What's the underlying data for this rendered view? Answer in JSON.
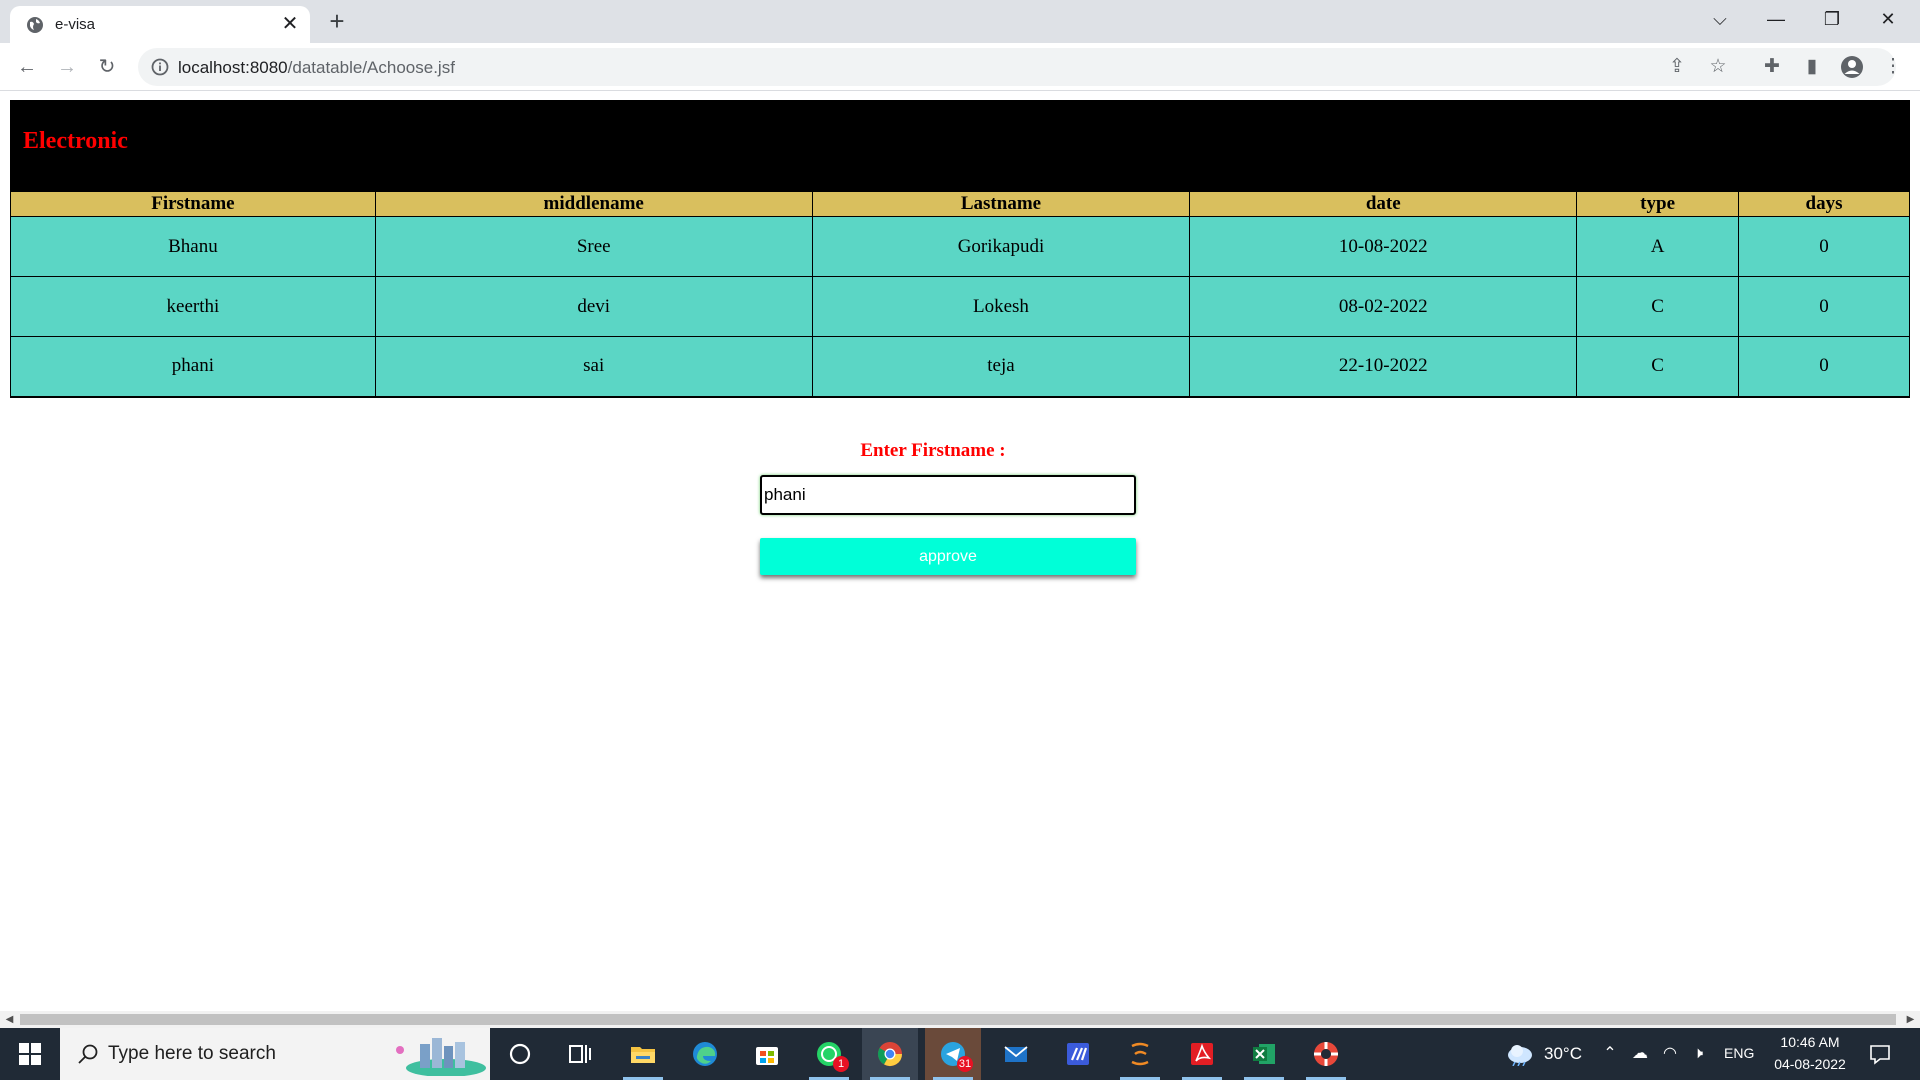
{
  "browser": {
    "tab_title": "e-visa",
    "url_host": "localhost:8080",
    "url_path": "/datatable/Achoose.jsf"
  },
  "page": {
    "banner_title": "Electronic",
    "table": {
      "headers": [
        "Firstname",
        "middlename",
        "Lastname",
        "date",
        "type",
        "days"
      ],
      "rows": [
        [
          "Bhanu",
          "Sree",
          "Gorikapudi",
          "10-08-2022",
          "A",
          "0"
        ],
        [
          "keerthi",
          "devi",
          "Lokesh",
          "08-02-2022",
          "C",
          "0"
        ],
        [
          "phani",
          "sai",
          "teja",
          "22-10-2022",
          "C",
          "0"
        ]
      ]
    },
    "form": {
      "label": "Enter Firstname :",
      "firstname_value": "phani",
      "approve_label": "approve"
    }
  },
  "taskbar": {
    "search_placeholder": "Type here to search",
    "whatsapp_badge": "1",
    "telegram_badge": "31",
    "temperature": "30°C",
    "language": "ENG",
    "time": "10:46 AM",
    "date": "04-08-2022"
  },
  "colors": {
    "banner_bg": "#000000",
    "banner_text": "#ff0000",
    "header_bg": "#d9bf5e",
    "row_bg": "#5bd6c5",
    "approve_bg": "#00ffd8",
    "label_text": "#ff0000"
  }
}
